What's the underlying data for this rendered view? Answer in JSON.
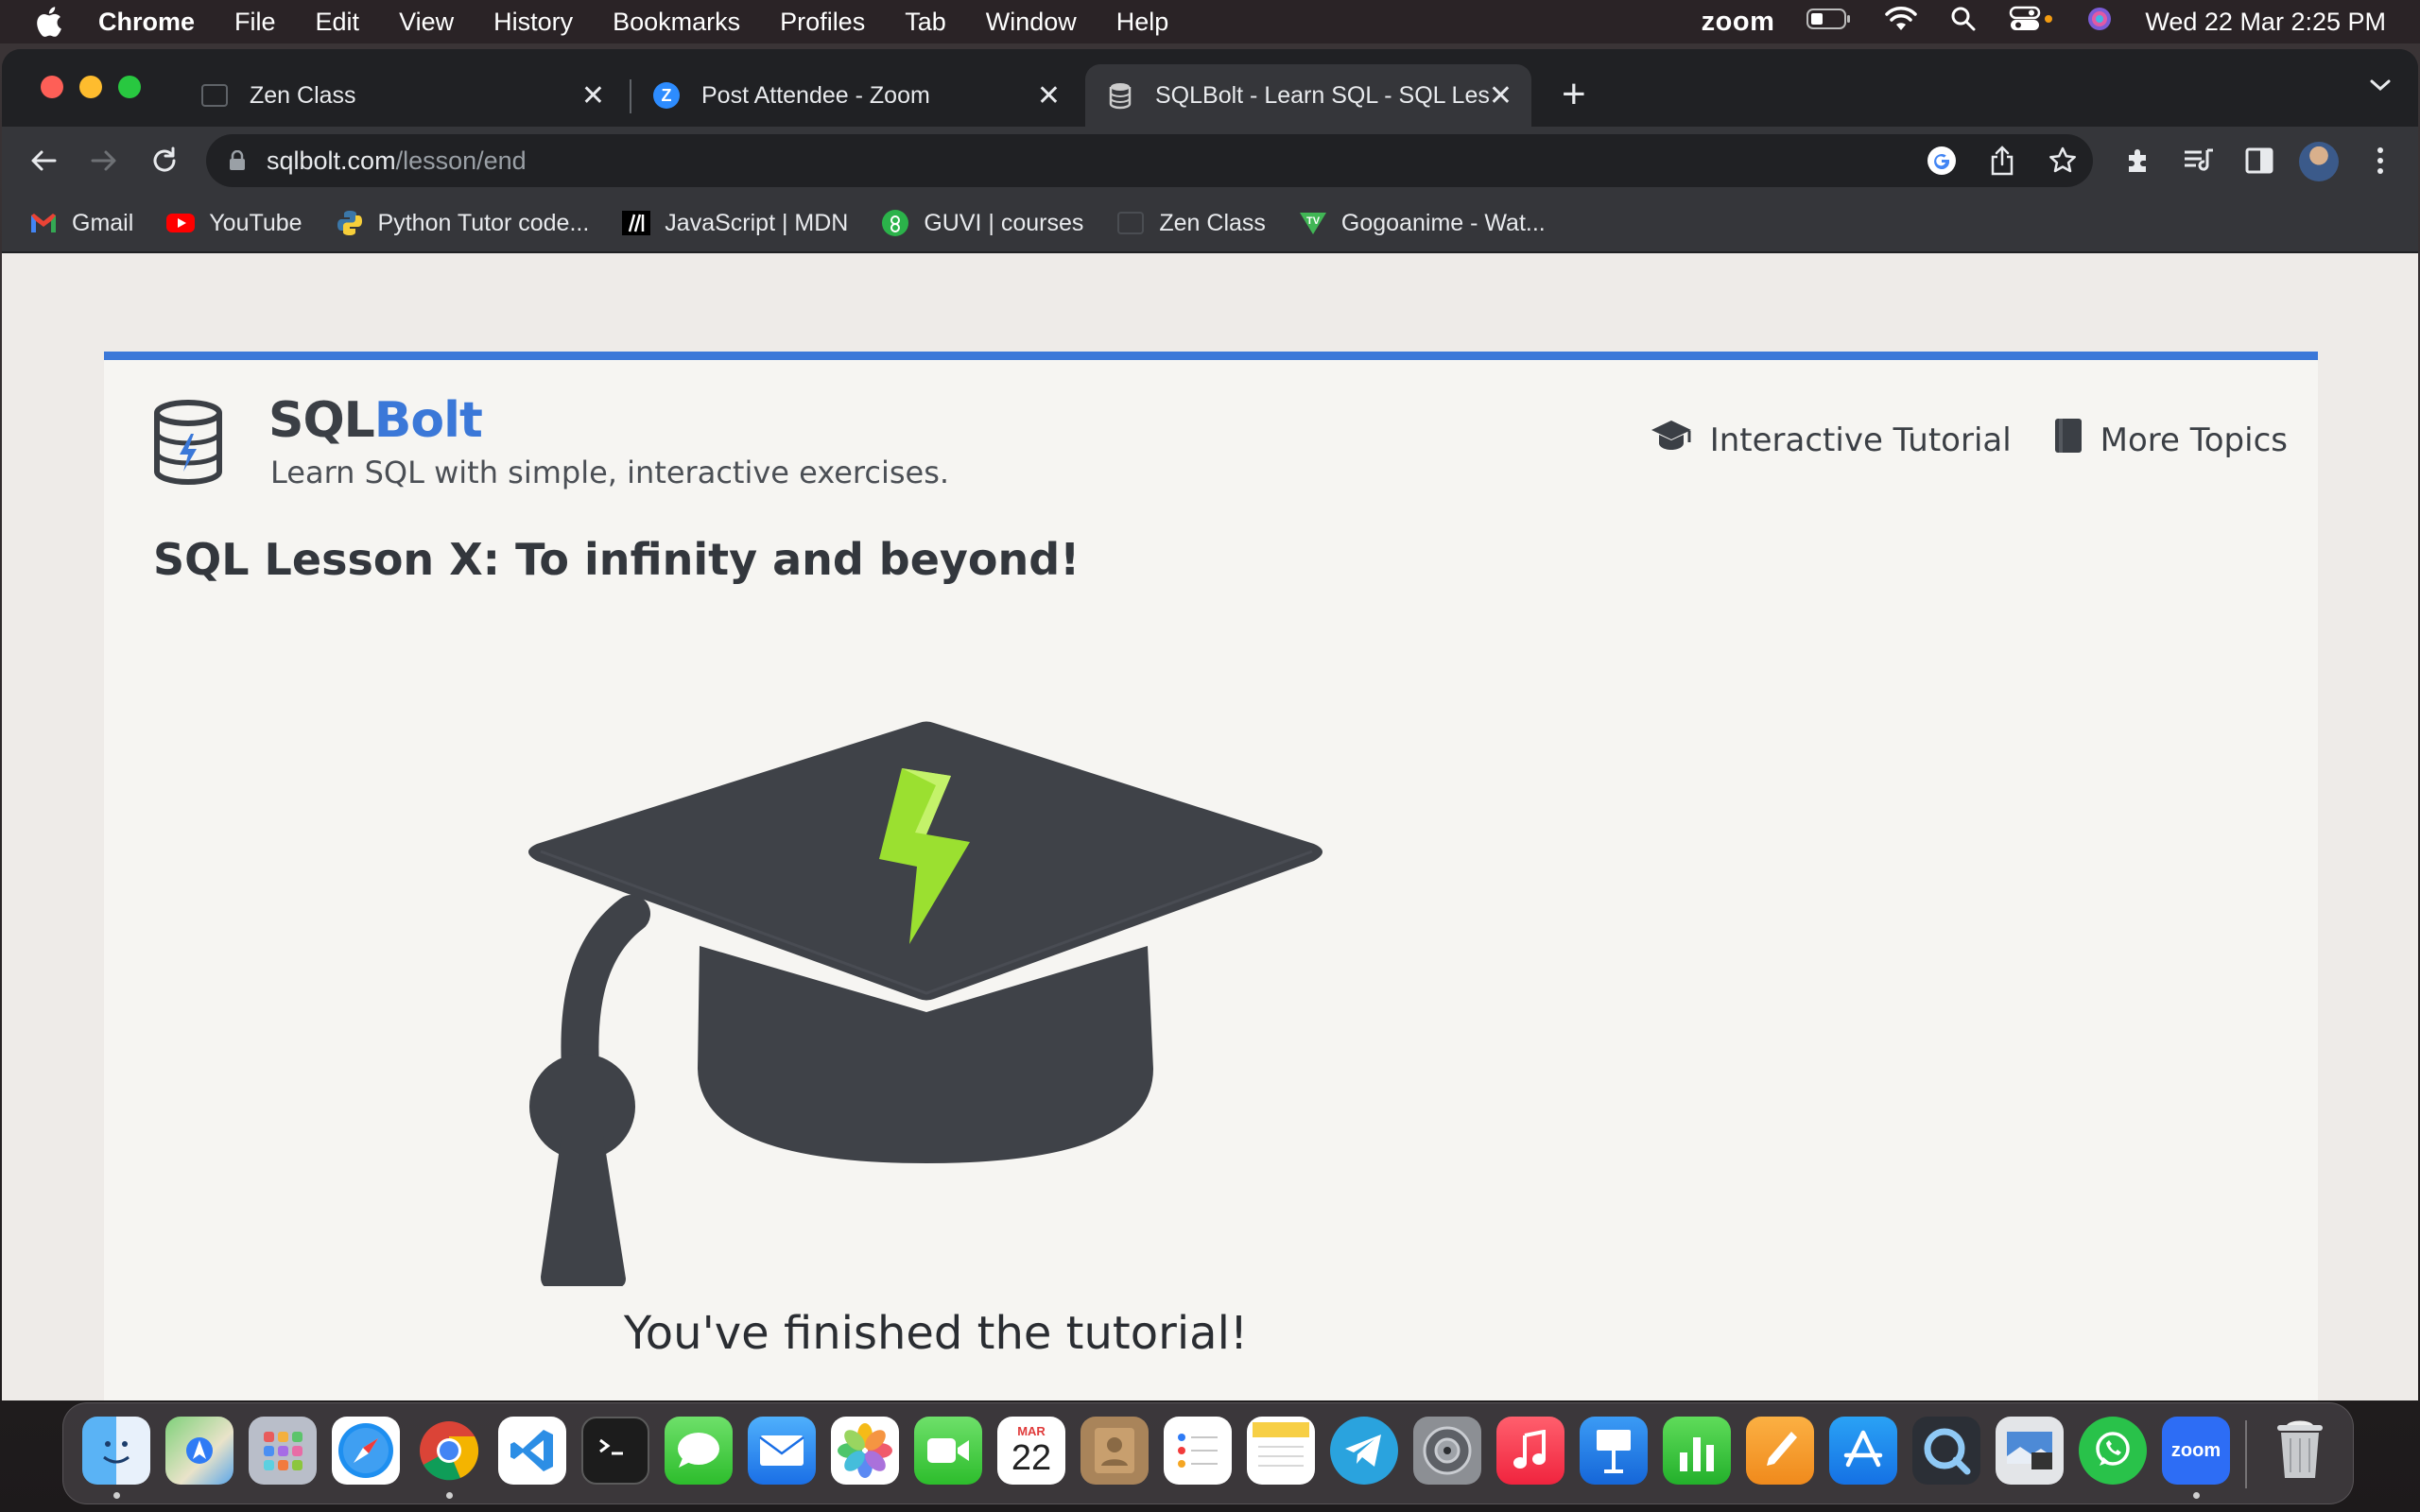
{
  "menubar": {
    "app": "Chrome",
    "items": [
      "File",
      "Edit",
      "View",
      "History",
      "Bookmarks",
      "Profiles",
      "Tab",
      "Window",
      "Help"
    ],
    "zoom_label": "zoom",
    "clock": "Wed 22 Mar  2:25 PM"
  },
  "tabs": [
    {
      "label": "Zen Class",
      "icon": "zen-class-favicon"
    },
    {
      "label": "Post Attendee - Zoom",
      "icon": "zoom-favicon"
    },
    {
      "label": "SQLBolt - Learn SQL - SQL Les",
      "icon": "sqlbolt-favicon",
      "active": true
    }
  ],
  "address_bar": {
    "host": "sqlbolt.com",
    "path": "/lesson/end"
  },
  "bookmarks": [
    {
      "label": "Gmail",
      "icon": "gmail-icon"
    },
    {
      "label": "YouTube",
      "icon": "youtube-icon"
    },
    {
      "label": "Python Tutor code...",
      "icon": "python-icon"
    },
    {
      "label": "JavaScript | MDN",
      "icon": "mdn-icon"
    },
    {
      "label": "GUVI | courses",
      "icon": "guvi-icon"
    },
    {
      "label": "Zen Class",
      "icon": "zen-class-icon"
    },
    {
      "label": "Gogoanime - Wat...",
      "icon": "gogoanime-icon"
    }
  ],
  "page": {
    "brand_part1": "SQL",
    "brand_part2": "Bolt",
    "tagline": "Learn SQL with simple, interactive exercises.",
    "nav": {
      "interactive_tutorial": "Interactive Tutorial",
      "more_topics": "More Topics"
    },
    "lesson_title": "SQL Lesson X: To infinity and beyond!",
    "finished_message": "You've finished the tutorial!",
    "accent_color": "#3b78d8"
  },
  "dock": {
    "calendar_month": "MAR",
    "calendar_day": "22",
    "zoom_label": "zoom",
    "apps": [
      "finder",
      "maps",
      "launchpad",
      "safari",
      "chrome",
      "vscode",
      "terminal",
      "messages",
      "mail",
      "photos",
      "facetime",
      "calendar",
      "contacts",
      "reminders",
      "notes",
      "telegram",
      "system-settings",
      "music",
      "keynote",
      "numbers",
      "pages",
      "app-store",
      "quicktime",
      "preview",
      "whatsapp",
      "zoom",
      "trash"
    ]
  }
}
